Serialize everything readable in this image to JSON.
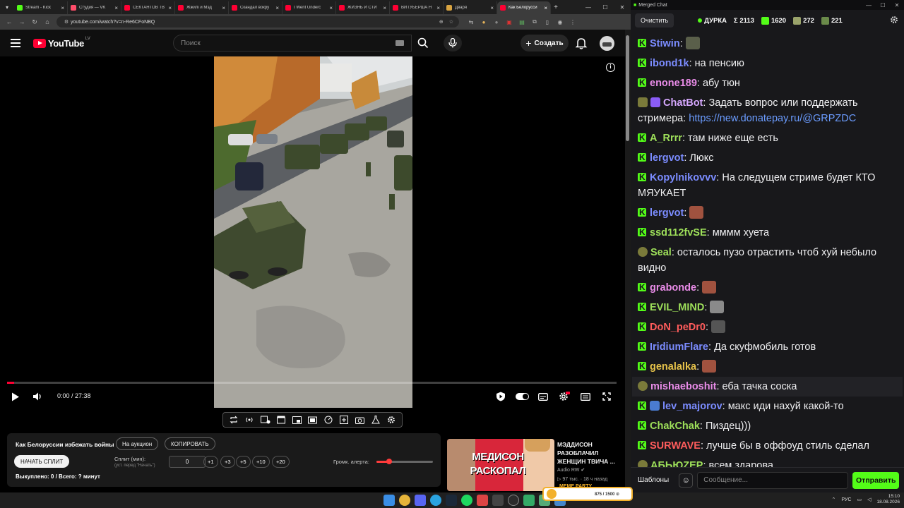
{
  "browser": {
    "tabs": [
      {
        "title": "Stream - Kick",
        "color": "#53fc18"
      },
      {
        "title": "Студия — VK",
        "color": "#ff4d6a"
      },
      {
        "title": "СЕКТАНТОВ ТВ",
        "color": "#ff0033"
      },
      {
        "title": "Жжилi и Мэд",
        "color": "#ff0033"
      },
      {
        "title": "Скандал вокру",
        "color": "#ff0033"
      },
      {
        "title": "I Went Underc",
        "color": "#ff0033"
      },
      {
        "title": "ЖИЗНЬ И СТИ",
        "color": "#ff0033"
      },
      {
        "title": "ВИТУБЕРША Н",
        "color": "#ff0033"
      },
      {
        "title": "Дваря",
        "color": "#d9a441"
      },
      {
        "title": "Как Белорусси",
        "color": "#ff0033",
        "active": true
      }
    ],
    "url": "youtube.com/watch?v=n-Re6CFoNBQ"
  },
  "youtube": {
    "logo": "YouTube",
    "country": "LV",
    "search_placeholder": "Поиск",
    "create_label": "Создать"
  },
  "player": {
    "time": "0:00 / 27:38",
    "progress_fraction": 0.0
  },
  "panel": {
    "title": "Как Белоруссии избежать войны",
    "auction_label": "На аукцион",
    "copy_label": "КОПИРОВАТЬ",
    "start_split_label": "НАЧАТЬ СПЛИТ",
    "split_label": "Сплит (мин):",
    "split_hint": "(уст. перед \"Начать\")",
    "split_value": "0",
    "steps": [
      "+1",
      "+3",
      "+5",
      "+10",
      "+20"
    ],
    "volume_label": "Громк. алерта:",
    "volume_fraction": 0.22,
    "bought": "Выкуплено: 0 / Всего: ? минут"
  },
  "recommended": {
    "thumb_line1": "МЕДИСОН",
    "thumb_line2": "РАСКОПАЛ",
    "title": "МЭДДИСОН РАЗОБЛАЧИЛ ЖЕНЩИН ТВИЧА ...",
    "channel": "Audio RW",
    "meta": "97 тыс. · 18 ч назад"
  },
  "chat": {
    "window_title": "Merged Chat",
    "clear_label": "Очистить",
    "stream_name": "ДУРКА",
    "stats": [
      {
        "icon": "sum",
        "value": "Σ 2113"
      },
      {
        "icon": "kick-logo",
        "value": "1620"
      },
      {
        "icon": "emote-viewers",
        "value": "272"
      },
      {
        "icon": "emote-viewers-2",
        "value": "221"
      }
    ],
    "messages": [
      {
        "badge": "kick",
        "nick": "Stiwin",
        "color": "#7b8cff",
        "text": "",
        "emote": "#5a5f4a"
      },
      {
        "badge": "kick",
        "nick": "ibond1k",
        "color": "#7b8cff",
        "text": "на пенсию"
      },
      {
        "badge": "kick",
        "nick": "enone189",
        "color": "#e98ce8",
        "text": "абу тюн"
      },
      {
        "badge": "bot",
        "nick": "ChatBot",
        "color": "#d6a8ff",
        "text": "Задать вопрос или поддержать стримера: ",
        "link": "https://new.donatepay.ru/@GRPZDC"
      },
      {
        "badge": "kick",
        "nick": "A_Rrrr",
        "color": "#9ee05a",
        "text": "там ниже еще есть"
      },
      {
        "badge": "kick",
        "nick": "lergvot",
        "color": "#7b8cff",
        "text": "Люкс"
      },
      {
        "badge": "kick",
        "nick": "Kopylnikovvv",
        "color": "#7b8cff",
        "text": "На следущем стриме будет КТО МЯУКАЕТ"
      },
      {
        "badge": "kick",
        "nick": "lergvot",
        "color": "#7b8cff",
        "text": "",
        "emote": "#a0523f"
      },
      {
        "badge": "kick",
        "nick": "ssd112fvSE",
        "color": "#9ee05a",
        "text": "мммм хуета"
      },
      {
        "badge": "tw",
        "nick": "Seal",
        "color": "#9ee05a",
        "text": "осталось пузо отрастить чтоб хуй небыло видно"
      },
      {
        "badge": "kick",
        "nick": "grabonde",
        "color": "#e98ce8",
        "text": "",
        "emote": "#a0523f"
      },
      {
        "badge": "kick",
        "nick": "EVIL_MIND",
        "color": "#9ee05a",
        "text": "",
        "emote": "#8a8a8a"
      },
      {
        "badge": "kick",
        "nick": "DoN_peDr0",
        "color": "#ff5c5c",
        "text": "",
        "emote": "#555"
      },
      {
        "badge": "kick",
        "nick": "IridiumFlare",
        "color": "#7b8cff",
        "text": "Да скуфмобиль готов"
      },
      {
        "badge": "kick",
        "nick": "genalalka",
        "color": "#e6c24a",
        "text": "",
        "emote": "#a0523f"
      },
      {
        "badge": "tw",
        "nick": "mishaeboshit",
        "color": "#e98ce8",
        "text": "еба тачка соска",
        "highlight": true
      },
      {
        "badge": "kick2",
        "nick": "lev_majorov",
        "color": "#7b8cff",
        "text": "макс иди нахуй какой-то"
      },
      {
        "badge": "kick",
        "nick": "ChakChak",
        "color": "#9ee05a",
        "text": "Пиздец)))"
      },
      {
        "badge": "kick",
        "nick": "SURWAVE",
        "color": "#ff5c5c",
        "text": "лучше бы в оффоуд стиль сделал"
      },
      {
        "badge": "tw",
        "nick": "АБЬЮZЕР",
        "color": "#9ee05a",
        "text": "всем здарова"
      }
    ],
    "templates_label": "Шаблоны",
    "input_placeholder": "Сообщение...",
    "send_label": "Отправить"
  },
  "taskbar": {
    "overlay_text": "875 / 1500 ⊙",
    "overlay_party": "MEME PARTY",
    "lang": "РУС",
    "time": "15:10",
    "date": "18.08.2026"
  }
}
